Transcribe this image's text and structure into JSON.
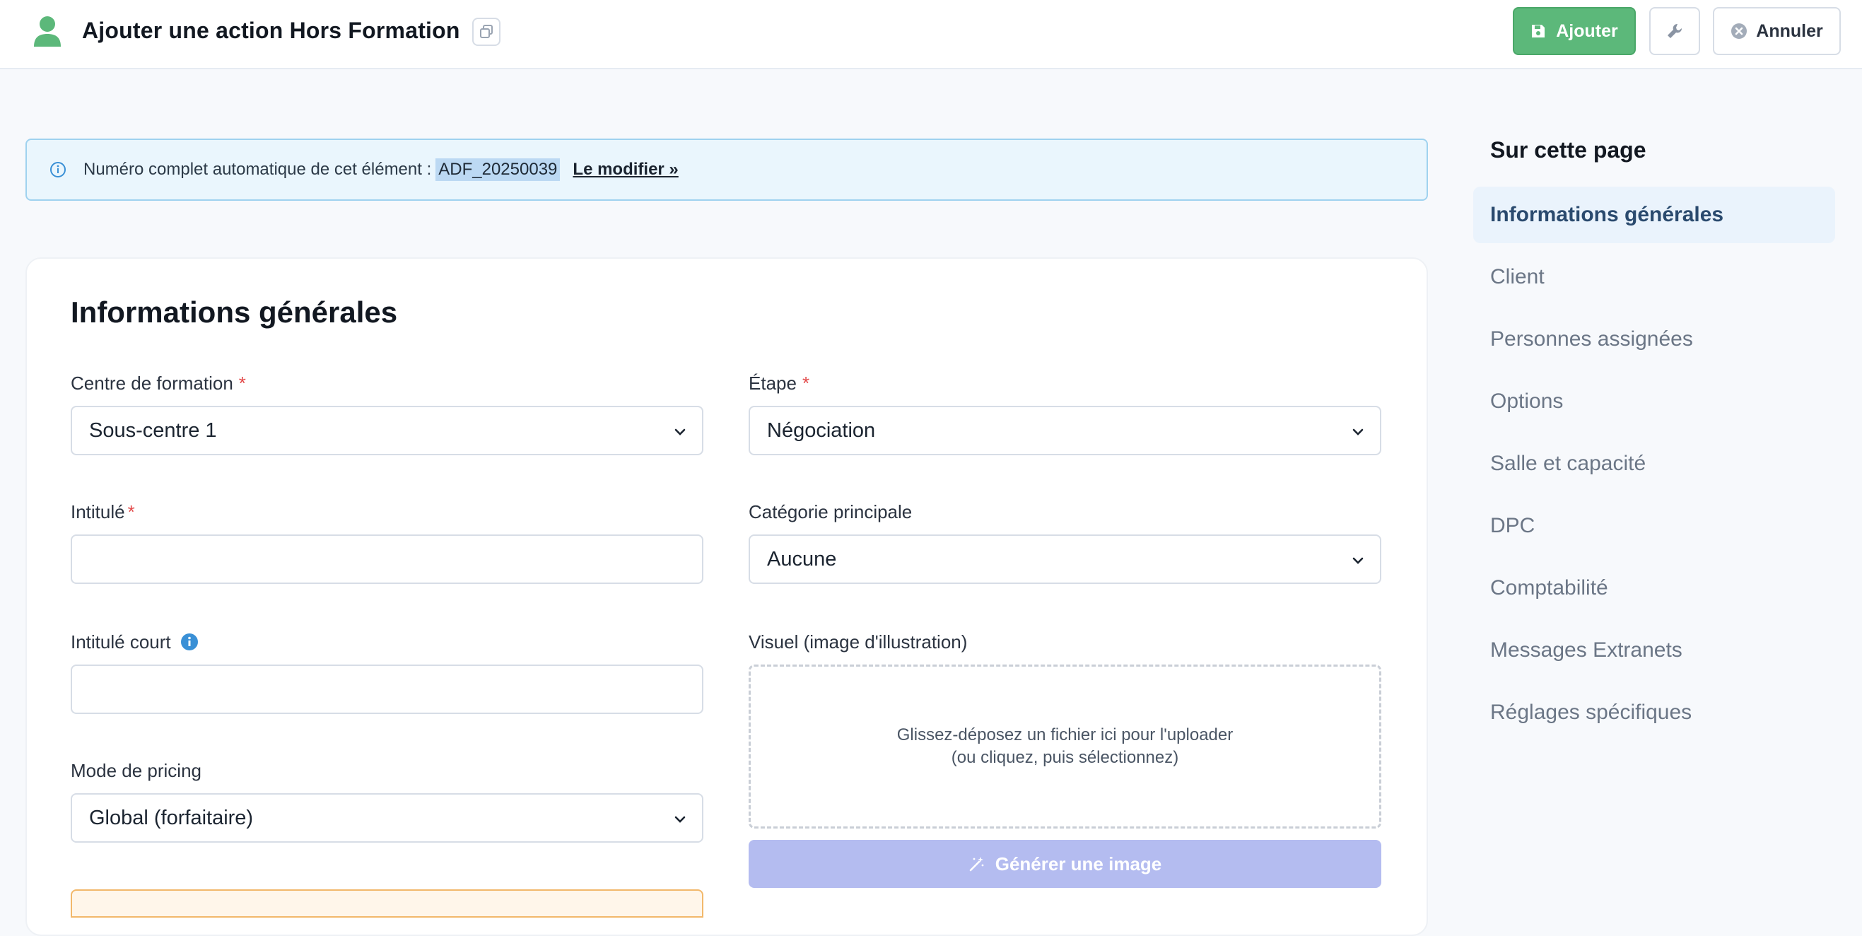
{
  "header": {
    "title": "Ajouter une action Hors Formation",
    "add_label": "Ajouter",
    "cancel_label": "Annuler",
    "icons": [
      "user-icon",
      "copy-icon",
      "save-icon",
      "wrench-icon",
      "close-circle-icon"
    ],
    "accent": "#5cb87a"
  },
  "banner": {
    "text": "Numéro complet automatique de cet élément :",
    "reference": "ADF_20250039",
    "modify_link": "Le modifier »"
  },
  "section": {
    "title": "Informations générales",
    "fields": {
      "centre": {
        "label": "Centre de formation",
        "required": "*",
        "value": "Sous-centre 1"
      },
      "etape": {
        "label": "Étape",
        "required": "*",
        "value": "Négociation"
      },
      "intitule": {
        "label": "Intitulé",
        "required": "*",
        "value": ""
      },
      "categorie": {
        "label": "Catégorie principale",
        "value": "Aucune"
      },
      "intitule_court": {
        "label": "Intitulé court",
        "value": ""
      },
      "visuel": {
        "label": "Visuel (image d'illustration)",
        "dropzone_line1": "Glissez-déposez un fichier ici pour l'uploader",
        "dropzone_line2": "(ou cliquez, puis sélectionnez)",
        "generate_label": "Générer une image"
      },
      "pricing": {
        "label": "Mode de pricing",
        "value": "Global (forfaitaire)"
      }
    }
  },
  "toc": {
    "title": "Sur cette page",
    "items": [
      "Informations générales",
      "Client",
      "Personnes assignées",
      "Options",
      "Salle et capacité",
      "DPC",
      "Comptabilité",
      "Messages Extranets",
      "Réglages spécifiques"
    ],
    "active_index": 0
  }
}
